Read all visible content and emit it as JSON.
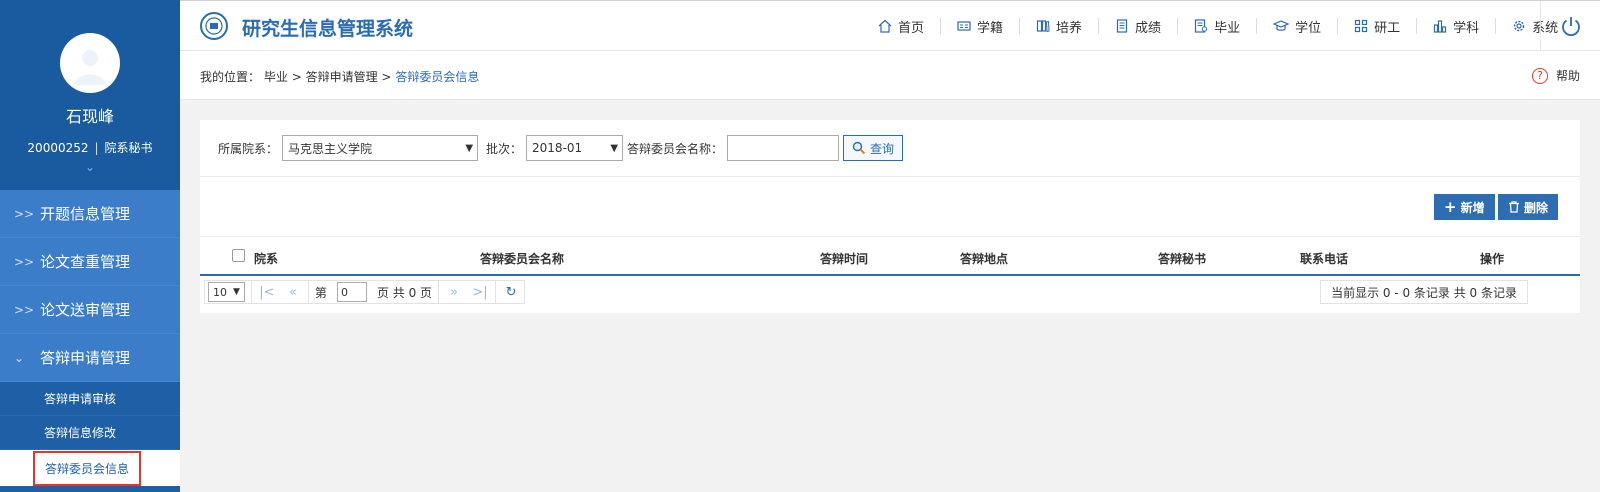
{
  "sidebar": {
    "user": {
      "name": "石现峰",
      "id": "20000252",
      "role": "院系秘书"
    },
    "menu": [
      {
        "label": "开题信息管理"
      },
      {
        "label": "论文查重管理"
      },
      {
        "label": "论文送审管理"
      },
      {
        "label": "答辩申请管理"
      }
    ],
    "submenu": [
      {
        "label": "答辩申请审核"
      },
      {
        "label": "答辩信息修改"
      },
      {
        "label": "答辩委员会信息"
      }
    ]
  },
  "header": {
    "title": "研究生信息管理系统",
    "nav": [
      {
        "label": "首页",
        "icon": "home-icon"
      },
      {
        "label": "学籍",
        "icon": "id-card-icon"
      },
      {
        "label": "培养",
        "icon": "book-icon"
      },
      {
        "label": "成绩",
        "icon": "document-icon"
      },
      {
        "label": "毕业",
        "icon": "certificate-icon"
      },
      {
        "label": "学位",
        "icon": "graduation-cap-icon"
      },
      {
        "label": "研工",
        "icon": "grid-icon"
      },
      {
        "label": "学科",
        "icon": "bar-chart-icon"
      },
      {
        "label": "系统",
        "icon": "gear-icon"
      }
    ]
  },
  "breadcrumb": {
    "prefix": "我的位置：",
    "item1": "毕业",
    "sep": ">",
    "item2": "答辩申请管理",
    "current": "答辩委员会信息"
  },
  "help_label": "帮助",
  "filter": {
    "dept_label": "所属院系：",
    "dept_value": "马克思主义学院",
    "batch_label": "批次：",
    "batch_value": "2018-01",
    "committee_label": "答辩委员会名称：",
    "committee_value": "",
    "query_label": "查询"
  },
  "actions": {
    "add_label": "新增",
    "delete_label": "删除"
  },
  "table": {
    "columns": [
      "院系",
      "答辩委员会名称",
      "答辩时间",
      "答辩地点",
      "答辩秘书",
      "联系电话",
      "操作"
    ],
    "rows": []
  },
  "pager": {
    "page_size": "10",
    "page_prefix": "第",
    "page_value": "0",
    "page_suffix": "页 共 0 页",
    "info": "当前显示 0 - 0 条记录 共 0 条记录"
  },
  "colors": {
    "primary": "#2b6cb0",
    "sidebar": "#1f5fa6",
    "menu": "#3b7dc9",
    "highlight": "#e8352c"
  }
}
